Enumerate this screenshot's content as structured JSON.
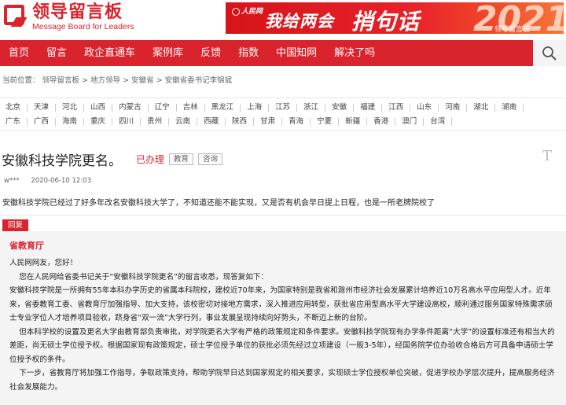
{
  "site": {
    "name_cn": "领导留言板",
    "name_en": "Message Board for Leaders"
  },
  "banner": {
    "brand": "人民网",
    "line1": "我给两会",
    "line2": "捎句话",
    "deco": "2021",
    "tag": "领导留言板"
  },
  "nav": {
    "items": [
      "首页",
      "留言",
      "政企直通车",
      "案例库",
      "反馈",
      "指数",
      "中国知网",
      "解决了吗"
    ],
    "search_icon": "search-icon"
  },
  "breadcrumb": [
    "当前位置：",
    "领导留言板",
    "地方领导",
    "安徽省",
    "安徽省委书记李锦斌"
  ],
  "regions": {
    "row1": [
      "北京",
      "天津",
      "河北",
      "山西",
      "内蒙古",
      "辽宁",
      "吉林",
      "黑龙江",
      "上海",
      "江苏",
      "浙江",
      "安徽",
      "福建",
      "江西",
      "山东",
      "河南",
      "湖北",
      "湖南"
    ],
    "row2": [
      "广东",
      "广西",
      "海南",
      "重庆",
      "四川",
      "贵州",
      "云南",
      "西藏",
      "陕西",
      "甘肃",
      "青海",
      "宁夏",
      "新疆",
      "香港",
      "澳门",
      "台湾"
    ]
  },
  "message": {
    "title": "安徽科技学院更名。",
    "status": "已办理",
    "tags": [
      "教育",
      "咨询"
    ],
    "font_toggle": "T",
    "author": "w***",
    "time": "2020-06-10 12:03",
    "content": "安徽科技学院已经过了好多年改名安徽科技大学了，不知道还能不能实现，又是否有机会早日提上日程，也是一所老牌院校了"
  },
  "reply": {
    "label": "回复",
    "replier": "省教育厅",
    "paragraphs": [
      "人民网网友，您好！",
      "    您在人民网给省委书记关于“安徽科技学院更名”的留言收悉，现答复如下：",
      "安徽科技学院是一所拥有55年本科办学历史的省属本科院校，建校近70年来，为国家特别是我省和滁州市经济社会发展累计培养近10万名高水平应用型人才。近年来，省委教育工委、省教育厅加强指导、加大支持，该校密切对接地方需求，深入推进应用转型，获批省应用型高水平大学建设高校，顺利通过服务国家特殊需求硕士专业学位人才培养项目验收，跻身省“双一流”大学行列，事业发展呈现持续向好势头，不断迈上新的台阶。",
      "    但本科学校的设置及更名大学由教育部负责审批，对学院更名大学有严格的政策规定和条件要求。安徽科技学院现有办学条件距离“大学”的设置标准还有相当大的差距，尚无硕士学位授予权。根据国家现有政策规定，硕士学位授予单位的获批必须先经过立项建设（一般3-5年），经国务院学位办验收合格后方可具备申请硕士学位授予权的条件。",
      "    下一步，省教育厅将加强工作指导，争取政策支持，帮助学院早日达到国家规定的相关要求，实现硕士学位授权单位突破，促进学校办学层次提升，提高服务经济社会发展能力。"
    ]
  }
}
